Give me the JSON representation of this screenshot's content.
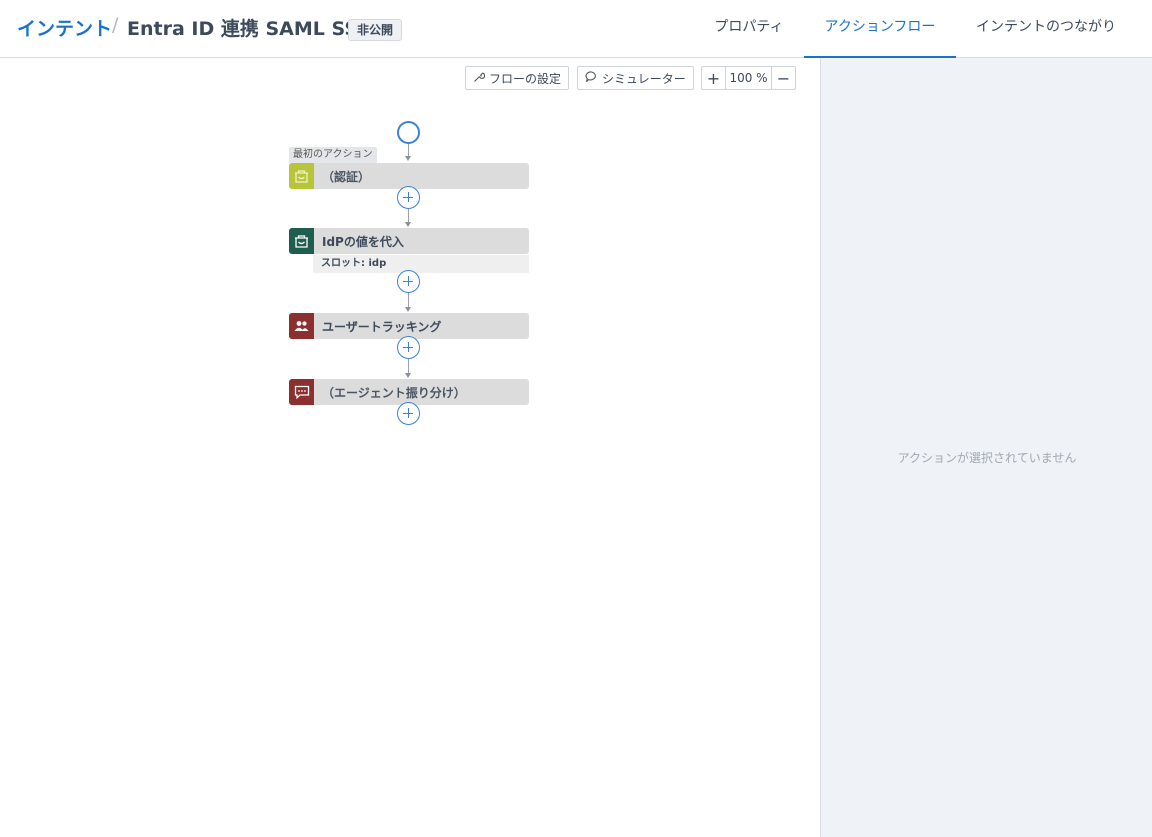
{
  "header": {
    "breadcrumb_root": "インテント",
    "breadcrumb_separator": "/",
    "title": "Entra ID 連携 SAML SSO",
    "status_badge": "非公開",
    "tabs": [
      {
        "label": "プロパティ",
        "active": false
      },
      {
        "label": "アクションフロー",
        "active": true
      },
      {
        "label": "インテントのつながり",
        "active": false
      }
    ]
  },
  "toolbar": {
    "flow_settings_label": "フローの設定",
    "simulator_label": "シミュレーター",
    "zoom_in_symbol": "+",
    "zoom_value": "100 %",
    "zoom_out_symbol": "−"
  },
  "flow": {
    "first_action_label": "最初のアクション",
    "actions": [
      {
        "label": "（認証）",
        "icon": "bag-icon",
        "icon_color": "#b8c43a",
        "dimmed": true
      },
      {
        "label": "IdPの値を代入",
        "icon": "bag-icon",
        "icon_color": "#1f5e4f",
        "sub_label": "スロット: idp"
      },
      {
        "label": "ユーザートラッキング",
        "icon": "users-icon",
        "icon_color": "#8b2f2f"
      },
      {
        "label": "（エージェント振り分け）",
        "icon": "chat-icon",
        "icon_color": "#8b2f2f"
      }
    ]
  },
  "panel": {
    "empty_message": "アクションが選択されていません"
  },
  "colors": {
    "accent": "#1a73c8",
    "panel_bg": "#eff3f7"
  }
}
